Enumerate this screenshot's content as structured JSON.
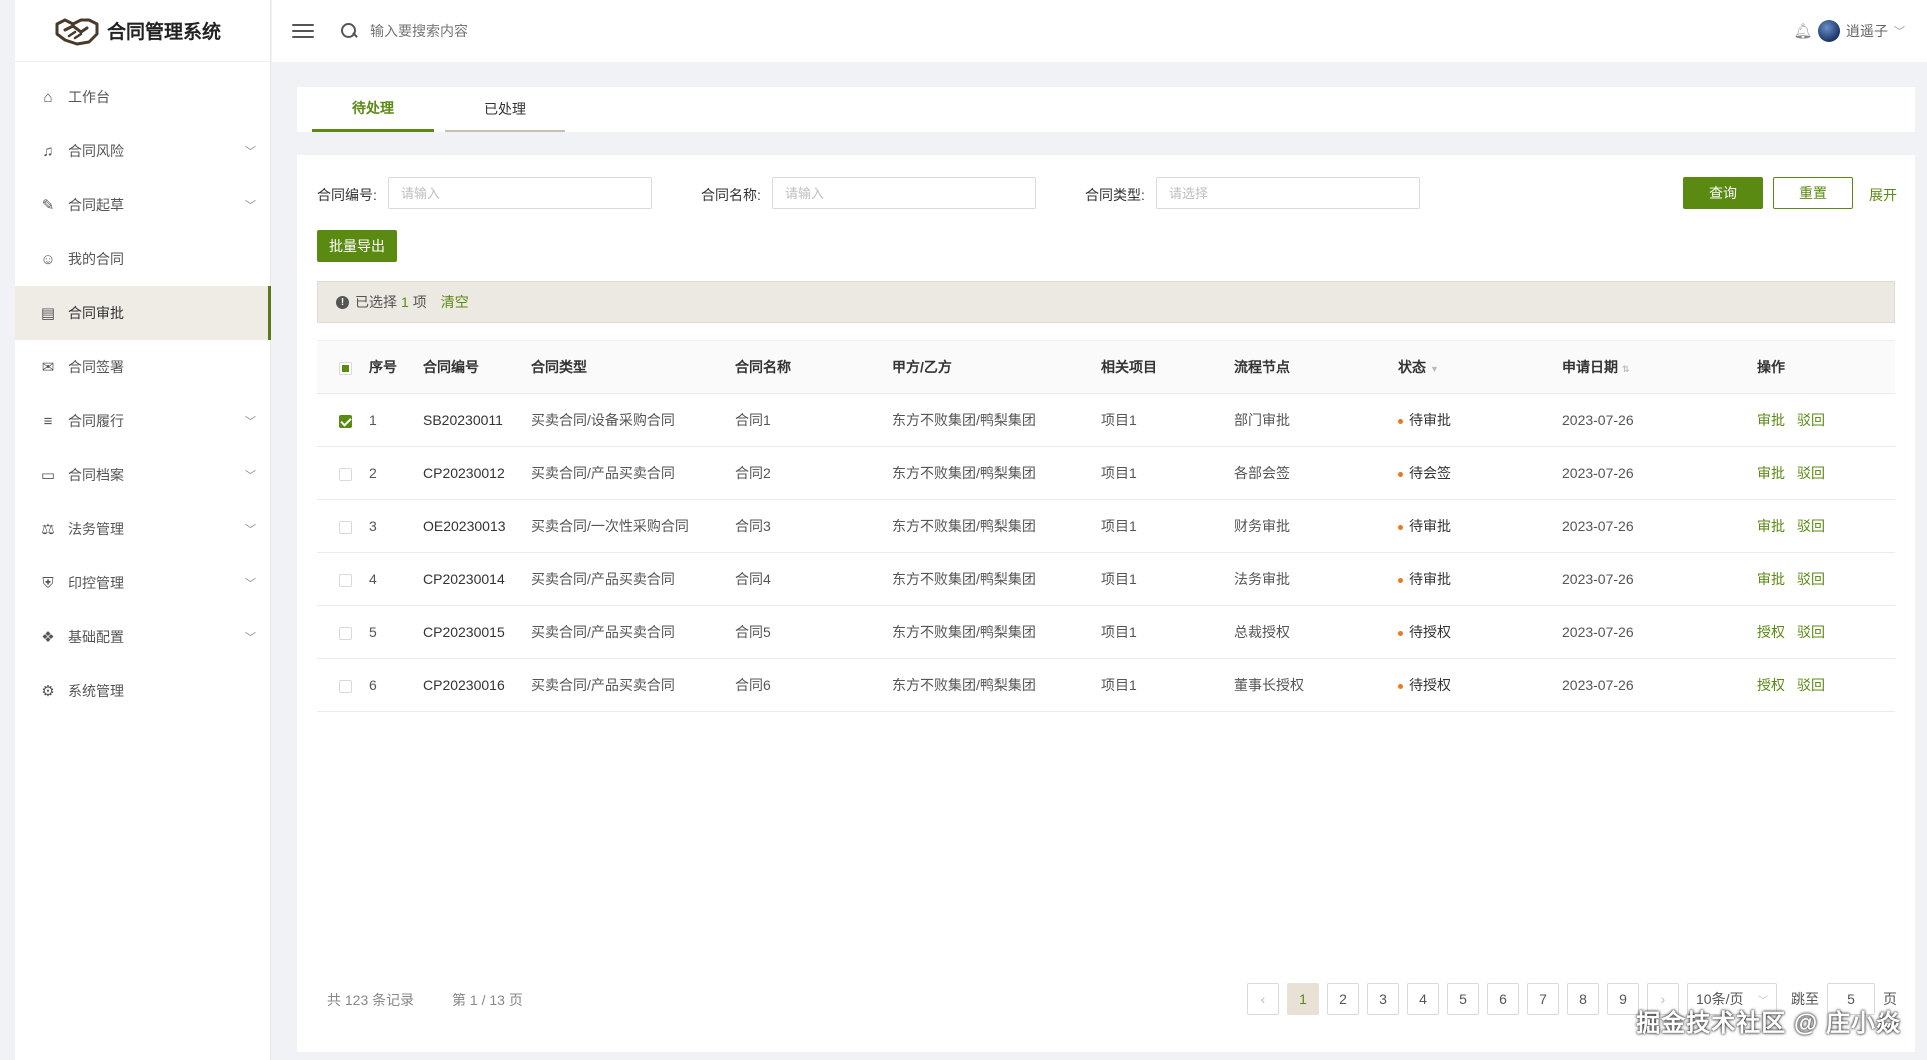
{
  "app": {
    "title": "合同管理系统"
  },
  "header": {
    "search_placeholder": "输入要搜索内容",
    "user_name": "逍遥子"
  },
  "sidebar": {
    "items": [
      {
        "label": "工作台",
        "icon": "home-icon",
        "glyph": "⌂",
        "has_arrow": false
      },
      {
        "label": "合同风险",
        "icon": "bell-icon",
        "glyph": "♫",
        "has_arrow": true
      },
      {
        "label": "合同起草",
        "icon": "edit-icon",
        "glyph": "✎",
        "has_arrow": true
      },
      {
        "label": "我的合同",
        "icon": "user-circle-icon",
        "glyph": "☺",
        "has_arrow": false
      },
      {
        "label": "合同审批",
        "icon": "id-card-icon",
        "glyph": "▤",
        "has_arrow": false,
        "active": true
      },
      {
        "label": "合同签署",
        "icon": "chat-icon",
        "glyph": "✉",
        "has_arrow": false
      },
      {
        "label": "合同履行",
        "icon": "list-icon",
        "glyph": "≡",
        "has_arrow": true
      },
      {
        "label": "合同档案",
        "icon": "laptop-icon",
        "glyph": "▭",
        "has_arrow": true
      },
      {
        "label": "法务管理",
        "icon": "gavel-icon",
        "glyph": "⚖",
        "has_arrow": true
      },
      {
        "label": "印控管理",
        "icon": "shield-icon",
        "glyph": "⛨",
        "has_arrow": true
      },
      {
        "label": "基础配置",
        "icon": "cubes-icon",
        "glyph": "❖",
        "has_arrow": true
      },
      {
        "label": "系统管理",
        "icon": "gear-icon",
        "glyph": "⚙",
        "has_arrow": false
      }
    ]
  },
  "tabs": [
    {
      "label": "待处理",
      "active": true
    },
    {
      "label": "已处理",
      "active": false
    }
  ],
  "filters": {
    "contract_no_label": "合同编号:",
    "contract_no_placeholder": "请输入",
    "contract_name_label": "合同名称:",
    "contract_name_placeholder": "请输入",
    "contract_type_label": "合同类型:",
    "contract_type_placeholder": "请选择",
    "query_button": "查询",
    "reset_button": "重置",
    "expand_link": "展开"
  },
  "batch_export_button": "批量导出",
  "selection_alert": {
    "prefix": "已选择",
    "count": "1",
    "suffix": "项",
    "clear": "清空"
  },
  "table": {
    "headers": [
      "序号",
      "合同编号",
      "合同类型",
      "合同名称",
      "甲方/乙方",
      "相关项目",
      "流程节点",
      "状态",
      "申请日期",
      "操作"
    ],
    "rows": [
      {
        "checked": true,
        "seq": "1",
        "no": "SB20230011",
        "type": "买卖合同/设备采购合同",
        "name": "合同1",
        "parties": "东方不败集团/鸭梨集团",
        "project": "项目1",
        "node": "部门审批",
        "status": "待审批",
        "date": "2023-07-26",
        "action1": "审批",
        "action2": "驳回"
      },
      {
        "checked": false,
        "seq": "2",
        "no": "CP20230012",
        "type": "买卖合同/产品买卖合同",
        "name": "合同2",
        "parties": "东方不败集团/鸭梨集团",
        "project": "项目1",
        "node": "各部会签",
        "status": "待会签",
        "date": "2023-07-26",
        "action1": "审批",
        "action2": "驳回"
      },
      {
        "checked": false,
        "seq": "3",
        "no": "OE20230013",
        "type": "买卖合同/一次性采购合同",
        "name": "合同3",
        "parties": "东方不败集团/鸭梨集团",
        "project": "项目1",
        "node": "财务审批",
        "status": "待审批",
        "date": "2023-07-26",
        "action1": "审批",
        "action2": "驳回"
      },
      {
        "checked": false,
        "seq": "4",
        "no": "CP20230014",
        "type": "买卖合同/产品买卖合同",
        "name": "合同4",
        "parties": "东方不败集团/鸭梨集团",
        "project": "项目1",
        "node": "法务审批",
        "status": "待审批",
        "date": "2023-07-26",
        "action1": "审批",
        "action2": "驳回"
      },
      {
        "checked": false,
        "seq": "5",
        "no": "CP20230015",
        "type": "买卖合同/产品买卖合同",
        "name": "合同5",
        "parties": "东方不败集团/鸭梨集团",
        "project": "项目1",
        "node": "总裁授权",
        "status": "待授权",
        "date": "2023-07-26",
        "action1": "授权",
        "action2": "驳回"
      },
      {
        "checked": false,
        "seq": "6",
        "no": "CP20230016",
        "type": "买卖合同/产品买卖合同",
        "name": "合同6",
        "parties": "东方不败集团/鸭梨集团",
        "project": "项目1",
        "node": "董事长授权",
        "status": "待授权",
        "date": "2023-07-26",
        "action1": "授权",
        "action2": "驳回"
      }
    ]
  },
  "pagination": {
    "total_text": "共 123 条记录",
    "page_text": "第 1 / 13 页",
    "pages": [
      "1",
      "2",
      "3",
      "4",
      "5",
      "6",
      "7",
      "8",
      "9"
    ],
    "current": "1",
    "page_size": "10条/页",
    "jump_label": "跳至",
    "jump_value": "5",
    "jump_suffix": "页"
  },
  "watermark": "掘金技术社区 @ 庄小焱",
  "colors": {
    "accent": "#5a8a12",
    "status_dot": "#e87b1d",
    "active_bg": "#efece5"
  }
}
